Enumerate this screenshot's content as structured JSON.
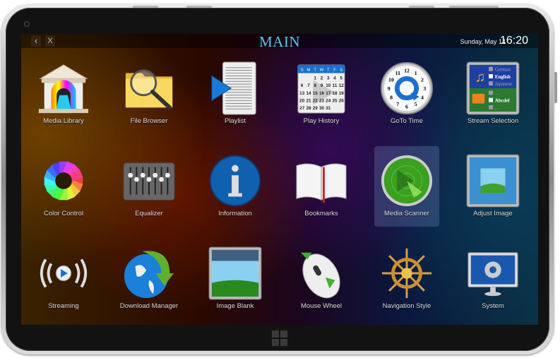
{
  "header": {
    "back_icon": "‹",
    "close_icon": "X",
    "title": "MAIN",
    "date": "Sunday, May 14",
    "time": "16:20"
  },
  "tiles": [
    {
      "label": "Media Library",
      "icon": "temple-film-icon"
    },
    {
      "label": "File Browser",
      "icon": "folder-magnifier-icon"
    },
    {
      "label": "Playlist",
      "icon": "playlist-icon"
    },
    {
      "label": "Play History",
      "icon": "calendar-icon"
    },
    {
      "label": "GoTo Time",
      "icon": "clock-icon"
    },
    {
      "label": "Stream Selection",
      "icon": "stream-selection-icon"
    },
    {
      "label": "Color Control",
      "icon": "color-wheel-icon"
    },
    {
      "label": "Equalizer",
      "icon": "equalizer-icon"
    },
    {
      "label": "Information",
      "icon": "info-icon"
    },
    {
      "label": "Bookmarks",
      "icon": "book-icon"
    },
    {
      "label": "Media Scanner",
      "icon": "radar-icon",
      "selected": true
    },
    {
      "label": "Adjust Image",
      "icon": "adjust-image-icon"
    },
    {
      "label": "Streaming",
      "icon": "streaming-icon"
    },
    {
      "label": "Download Manager",
      "icon": "globe-download-icon"
    },
    {
      "label": "Image Blank",
      "icon": "image-blank-icon"
    },
    {
      "label": "Mouse Wheel",
      "icon": "mouse-wheel-icon"
    },
    {
      "label": "Navigation Style",
      "icon": "ship-wheel-icon"
    },
    {
      "label": "System",
      "icon": "monitor-gear-icon"
    }
  ],
  "calendar": {
    "days": [
      "S",
      "M",
      "T",
      "W",
      "T",
      "F",
      "S"
    ],
    "dates": [
      "",
      "",
      "1",
      "2",
      "3",
      "4",
      "5",
      "6",
      "7",
      "8",
      "9",
      "10",
      "11",
      "12",
      "13",
      "14",
      "15",
      "16",
      "17",
      "18",
      "19",
      "20",
      "21",
      "22",
      "23",
      "24",
      "25",
      "26",
      "27",
      "28",
      "29",
      "30",
      "31"
    ]
  },
  "stream_selection": {
    "audio": [
      {
        "label": "German",
        "checked": false
      },
      {
        "label": "English",
        "checked": true
      },
      {
        "label": "Japanese",
        "checked": false
      }
    ],
    "subtitles": [
      {
        "label": "…",
        "checked": false
      },
      {
        "label": "Abcdef",
        "checked": true
      },
      {
        "label": "…",
        "checked": false
      }
    ]
  },
  "clock": {
    "numbers": [
      "12",
      "1",
      "2",
      "3",
      "4",
      "5",
      "6",
      "7",
      "8",
      "9",
      "10",
      "11"
    ]
  },
  "colors": {
    "title": "#56c8f0",
    "accent_blue": "#1a7ad8"
  }
}
